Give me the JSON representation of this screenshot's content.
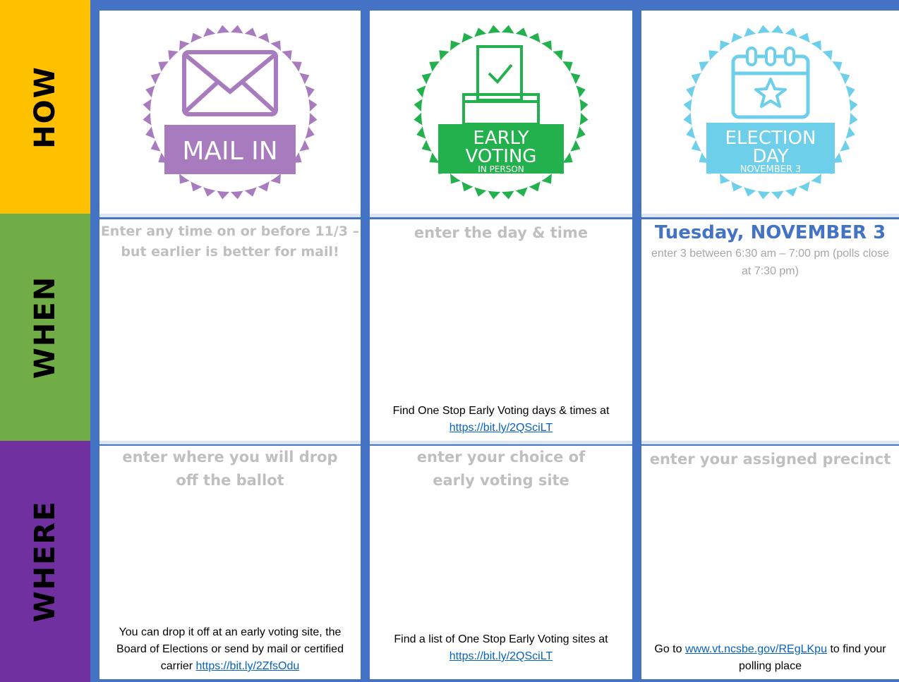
{
  "sidebar": {
    "how": "HOW",
    "when": "WHEN",
    "where": "WHERE"
  },
  "colors": {
    "how": "#FFC000",
    "when": "#70AD47",
    "where": "#7030A0",
    "grid": "#4472C4",
    "link": "#0563C1"
  },
  "badges": {
    "mail": {
      "line1": "MAIL IN",
      "icon": "envelope-icon",
      "color": "#A77BBE"
    },
    "early": {
      "line1": "EARLY",
      "line2": "VOTING",
      "line3": "IN PERSON",
      "icon": "ballot-box-icon",
      "color": "#22B14C"
    },
    "eday": {
      "line1": "ELECTION",
      "line2": "DAY",
      "line3": "NOVEMBER 3",
      "icon": "calendar-star-icon",
      "color": "#6DCFEA"
    }
  },
  "when": {
    "mail_prompt": "Enter any time on or before 11/3 – but earlier is better for mail!",
    "early_prompt": "enter the day & time",
    "early_foot_text": "Find One Stop Early Voting days & times at",
    "early_foot_link": "https://bit.ly/2QSciLT",
    "eday_date": "Tuesday, NOVEMBER 3",
    "eday_time": "enter 3 between 6:30 am – 7:00 pm (polls close at 7:30 pm)"
  },
  "where": {
    "mail_prompt": "enter where you will drop off the ballot",
    "mail_foot_text": "You can drop it off at an early voting site, the Board of Elections or send by mail or certified carrier",
    "mail_foot_link": "https://bit.ly/2ZfsOdu",
    "early_prompt": "enter your choice of early voting site",
    "early_foot_text": "Find a list of  One Stop Early Voting sites at",
    "early_foot_link": "https://bit.ly/2QSciLT",
    "eday_prompt": "enter your assigned precinct",
    "eday_foot_pre": "Go to",
    "eday_foot_link": "www.vt.ncsbe.gov/REgLKpu",
    "eday_foot_post": "to find your polling place"
  }
}
